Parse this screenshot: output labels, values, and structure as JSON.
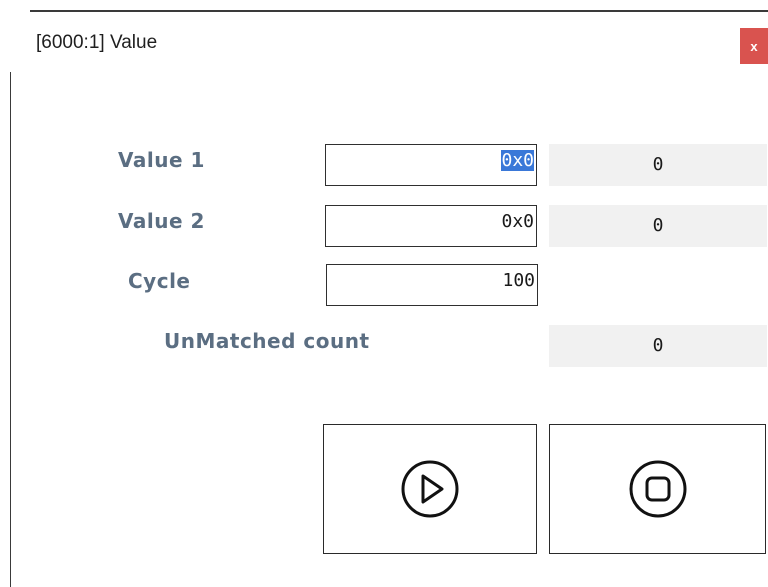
{
  "window": {
    "title": "[6000:1] Value",
    "close_label": "x"
  },
  "fields": {
    "value1": {
      "label": "Value 1",
      "input": "0x0",
      "readout": "0"
    },
    "value2": {
      "label": "Value 2",
      "input": "0x0",
      "readout": "0"
    },
    "cycle": {
      "label": "Cycle",
      "input": "100"
    },
    "unmatched": {
      "label": "UnMatched count",
      "readout": "0"
    }
  },
  "buttons": {
    "start_icon": "play-icon",
    "stop_icon": "stop-icon"
  },
  "colors": {
    "close_bg": "#d9534f",
    "label": "#5b6e82",
    "readout_bg": "#f1f1f1",
    "selection": "#3a78d8"
  }
}
